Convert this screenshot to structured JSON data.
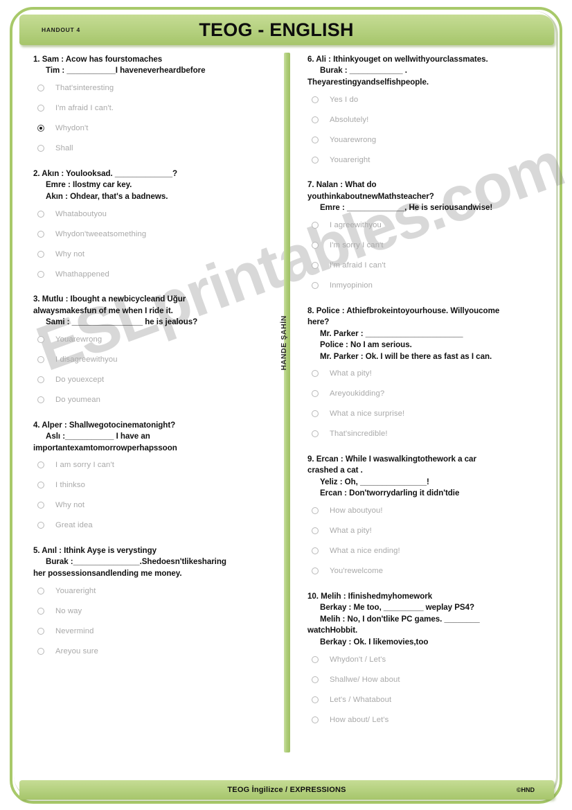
{
  "header": {
    "handout_label": "HANDOUT 4",
    "title": "TEOG - ENGLISH"
  },
  "divider": {
    "author_label": "HANDE ŞAHİN"
  },
  "watermark": {
    "text": "ESLprintables.com"
  },
  "footer": {
    "title": "TEOG İngilizce / EXPRESSIONS",
    "credit": "©HND"
  },
  "colors": {
    "accent_green": "#b4d07e",
    "border_green": "#a8c96a",
    "option_text": "#a9a9a9",
    "question_text": "#111111"
  },
  "questions": [
    {
      "number": "1",
      "lines": [
        {
          "text": "1. Sam : Acow has fourstomaches",
          "indent": false
        },
        {
          "text": "Tim : ___________I haveneverheardbefore",
          "indent": true
        }
      ],
      "options": [
        {
          "label": "That'sinteresting",
          "checked": false
        },
        {
          "label": "I'm afraid I can't.",
          "checked": false
        },
        {
          "label": "Whydon't",
          "checked": true
        },
        {
          "label": "Shall",
          "checked": false
        }
      ]
    },
    {
      "number": "2",
      "lines": [
        {
          "text": "2. Akın : Youlooksad. _____________?",
          "indent": false
        },
        {
          "text": "Emre : Ilostmy car key.",
          "indent": true
        },
        {
          "text": "Akın : Ohdear, that's a badnews.",
          "indent": true
        }
      ],
      "options": [
        {
          "label": "Whataboutyou",
          "checked": false
        },
        {
          "label": "Whydon'tweeatsomething",
          "checked": false
        },
        {
          "label": "Why not",
          "checked": false
        },
        {
          "label": "Whathappened",
          "checked": false
        }
      ]
    },
    {
      "number": "3",
      "lines": [
        {
          "text": "3. Mutlu : Ibought a newbicycleand Uğur",
          "indent": false
        },
        {
          "text": "alwaysmakesfun of me when I ride it.",
          "indent": false
        },
        {
          "text": "Sami : ________________ he is jealous?",
          "indent": true
        }
      ],
      "options": [
        {
          "label": "Youarewrong",
          "checked": false
        },
        {
          "label": "I disagreewithyou",
          "checked": false
        },
        {
          "label": "Do youexcept",
          "checked": false
        },
        {
          "label": "Do youmean",
          "checked": false
        }
      ]
    },
    {
      "number": "4",
      "lines": [
        {
          "text": "4. Alper : Shallwegotocinematonight?",
          "indent": false
        },
        {
          "text": "Aslı :___________ I have an",
          "indent": true
        },
        {
          "text": "importantexamtomorrowperhapssoon",
          "indent": false
        }
      ],
      "options": [
        {
          "label": "I am sorry I can't",
          "checked": false
        },
        {
          "label": "I thinkso",
          "checked": false
        },
        {
          "label": "Why not",
          "checked": false
        },
        {
          "label": "Great idea",
          "checked": false
        }
      ]
    },
    {
      "number": "5",
      "lines": [
        {
          "text": "5. Anıl : Ithink Ayşe is verystingy",
          "indent": false
        },
        {
          "text": "Burak :_______________.Shedoesn'tlikesharing",
          "indent": true
        },
        {
          "text": "her possessionsandlending me money.",
          "indent": false
        }
      ],
      "options": [
        {
          "label": "Youareright",
          "checked": false
        },
        {
          "label": "No way",
          "checked": false
        },
        {
          "label": "Nevermind",
          "checked": false
        },
        {
          "label": "Areyou sure",
          "checked": false
        }
      ]
    },
    {
      "number": "6",
      "lines": [
        {
          "text": "6. Ali : Ithinkyouget on wellwithyourclassmates.",
          "indent": false
        },
        {
          "text": "Burak : ____________ .",
          "indent": true
        },
        {
          "text": "Theyarestingyandselfishpeople.",
          "indent": false
        }
      ],
      "options": [
        {
          "label": "Yes I do",
          "checked": false
        },
        {
          "label": "Absolutely!",
          "checked": false
        },
        {
          "label": "Youarewrong",
          "checked": false
        },
        {
          "label": "Youareright",
          "checked": false
        }
      ]
    },
    {
      "number": "7",
      "lines": [
        {
          "text": "7. Nalan : What do",
          "indent": false
        },
        {
          "text": "youthinkaboutnewMathsteacher?",
          "indent": false
        },
        {
          "text": "Emre : _____________, He is seriousandwise!",
          "indent": true
        }
      ],
      "options": [
        {
          "label": "I agreewithyou",
          "checked": false
        },
        {
          "label": "I'm sorry I can't",
          "checked": false
        },
        {
          "label": "I'm afraid I can't",
          "checked": false
        },
        {
          "label": "Inmyopinion",
          "checked": false
        }
      ]
    },
    {
      "number": "8",
      "lines": [
        {
          "text": "8. Police : Athiefbrokeintoyourhouse. Willyoucome",
          "indent": false
        },
        {
          "text": "here?",
          "indent": false
        },
        {
          "text": "Mr. Parker : ______________________",
          "indent": true
        },
        {
          "text": "Police : No I am serious.",
          "indent": true
        },
        {
          "text": "Mr. Parker : Ok. I will be there as fast as I can.",
          "indent": true
        }
      ],
      "options": [
        {
          "label": "What a pity!",
          "checked": false
        },
        {
          "label": "Areyoukidding?",
          "checked": false
        },
        {
          "label": "What a nice surprise!",
          "checked": false
        },
        {
          "label": "That'sincredible!",
          "checked": false
        }
      ]
    },
    {
      "number": "9",
      "lines": [
        {
          "text": "9. Ercan : While I waswalkingtothework a car",
          "indent": false
        },
        {
          "text": "crashed a cat .",
          "indent": false
        },
        {
          "text": "Yeliz : Oh, _______________!",
          "indent": true
        },
        {
          "text": "Ercan : Don'tworrydarling it didn'tdie",
          "indent": true
        }
      ],
      "options": [
        {
          "label": "How aboutyou!",
          "checked": false
        },
        {
          "label": "What a pity!",
          "checked": false
        },
        {
          "label": "What a nice ending!",
          "checked": false
        },
        {
          "label": "You'rewelcome",
          "checked": false
        }
      ]
    },
    {
      "number": "10",
      "lines": [
        {
          "text": "10. Melih : Ifinishedmyhomework",
          "indent": false
        },
        {
          "text": "Berkay : Me too, _________ weplay PS4?",
          "indent": true
        },
        {
          "text": "Melih : No, I don'tlike PC games. ________",
          "indent": true
        },
        {
          "text": "watchHobbit.",
          "indent": false
        },
        {
          "text": "Berkay : Ok. I likemovies,too",
          "indent": true
        }
      ],
      "options": [
        {
          "label": "Whydon't / Let's",
          "checked": false
        },
        {
          "label": "Shallwe/ How about",
          "checked": false
        },
        {
          "label": "Let's / Whatabout",
          "checked": false
        },
        {
          "label": "How about/ Let's",
          "checked": false
        }
      ]
    }
  ]
}
